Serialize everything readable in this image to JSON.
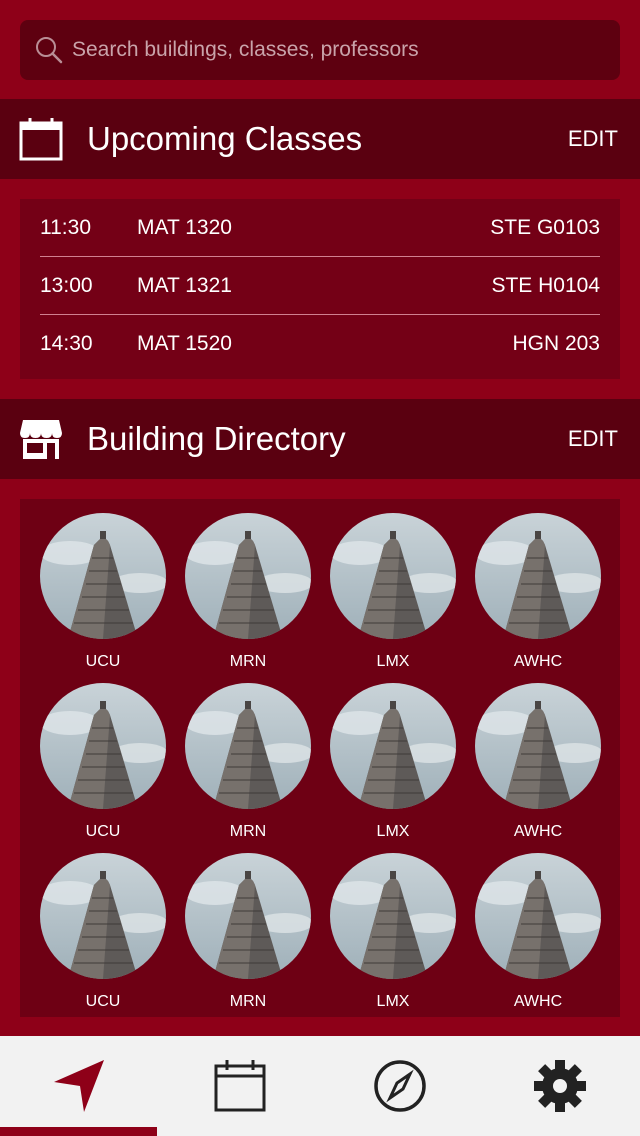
{
  "search": {
    "placeholder": "Search buildings, classes, professors"
  },
  "upcoming": {
    "title": "Upcoming Classes",
    "edit_label": "EDIT",
    "classes": [
      {
        "time": "11:30",
        "course": "MAT 1320",
        "room": "STE G0103"
      },
      {
        "time": "13:00",
        "course": "MAT 1321",
        "room": "STE H0104"
      },
      {
        "time": "14:30",
        "course": "MAT 1520",
        "room": "HGN 203"
      }
    ]
  },
  "directory": {
    "title": "Building Directory",
    "edit_label": "EDIT",
    "buildings": [
      "UCU",
      "MRN",
      "LMX",
      "AWHC",
      "UCU",
      "MRN",
      "LMX",
      "AWHC",
      "UCU",
      "MRN",
      "LMX",
      "AWHC"
    ]
  },
  "tabs": [
    {
      "icon": "navigation-arrow-icon",
      "active": true
    },
    {
      "icon": "calendar-icon",
      "active": false
    },
    {
      "icon": "compass-icon",
      "active": false
    },
    {
      "icon": "gear-icon",
      "active": false
    }
  ],
  "colors": {
    "background": "#8e0018",
    "header": "#5a0010",
    "card": "#740016",
    "tabbar": "#f2f2f2",
    "accent": "#8e0018"
  }
}
